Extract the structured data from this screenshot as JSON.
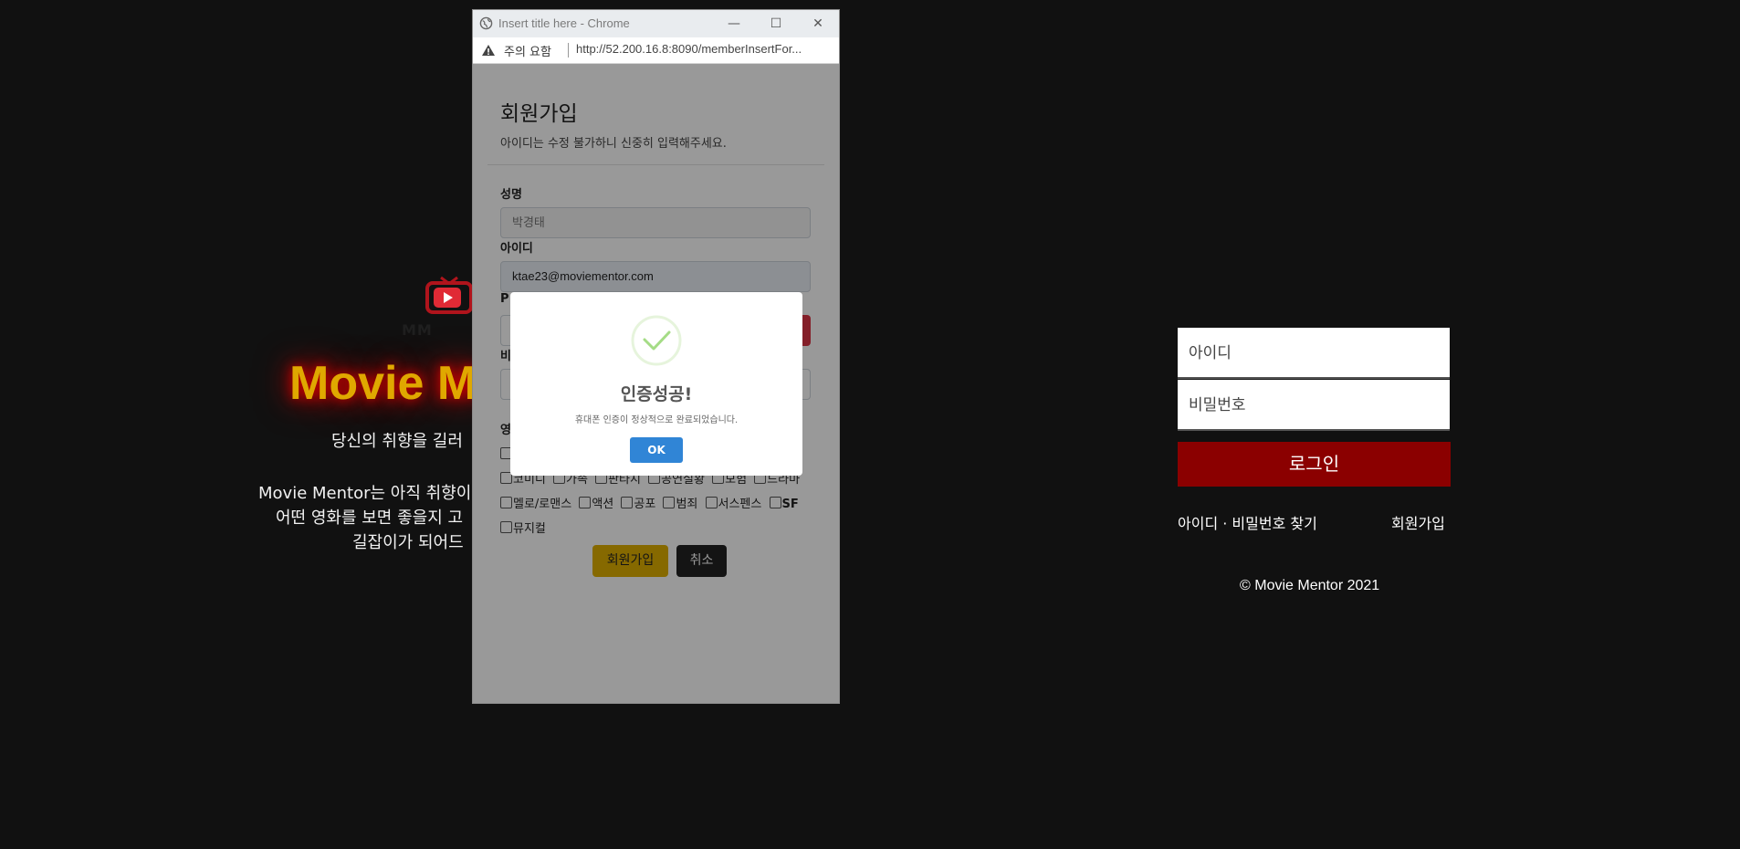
{
  "landing": {
    "logo_mark": "MM",
    "logo_icon": "tv-play-icon",
    "brand_title": "Movie M",
    "tagline": "당신의 취향을 길러",
    "description_lines": [
      "Movie Mentor는 아직 취향이",
      "어떤 영화를 보면 좋을지 고",
      "길잡이가 되어드"
    ]
  },
  "login": {
    "id_placeholder": "아이디",
    "password_placeholder": "비밀번호",
    "login_button": "로그인",
    "find_link": "아이디 · 비밀번호 찾기",
    "signup_link": "회원가입",
    "copyright": "© Movie Mentor 2021"
  },
  "popup": {
    "window_title": "Insert title here - Chrome",
    "security_warning": "주의 요함",
    "url": "http://52.200.16.8:8090/memberInsertFor...",
    "form": {
      "title": "회원가입",
      "subtitle": "아이디는 수정 불가하니 신중히 입력해주세요.",
      "name_label": "성명",
      "name_value": "박경태",
      "id_label": "아이디",
      "id_value": "ktae23@moviementor.com",
      "phone_label": "P",
      "code_label": "비",
      "genre_label": "영",
      "genres": [
        "코미디",
        "가족",
        "판타지",
        "공연실황",
        "모험",
        "드라마",
        "멜로/로맨스",
        "액션",
        "공포",
        "범죄",
        "서스펜스",
        "SF",
        "뮤지컬"
      ],
      "submit_button": "회원가입",
      "cancel_button": "취소"
    },
    "alert": {
      "icon": "success-check-icon",
      "title": "인증성공!",
      "text": "휴대폰 인증이 정상적으로 완료되었습니다.",
      "ok_button": "OK"
    }
  },
  "colors": {
    "background": "#111111",
    "brand_gold": "#e0a800",
    "login_button": "#8b0000",
    "submit_button": "#e0b000",
    "alert_ok": "#3085d6",
    "success_green": "#a5dc86"
  }
}
